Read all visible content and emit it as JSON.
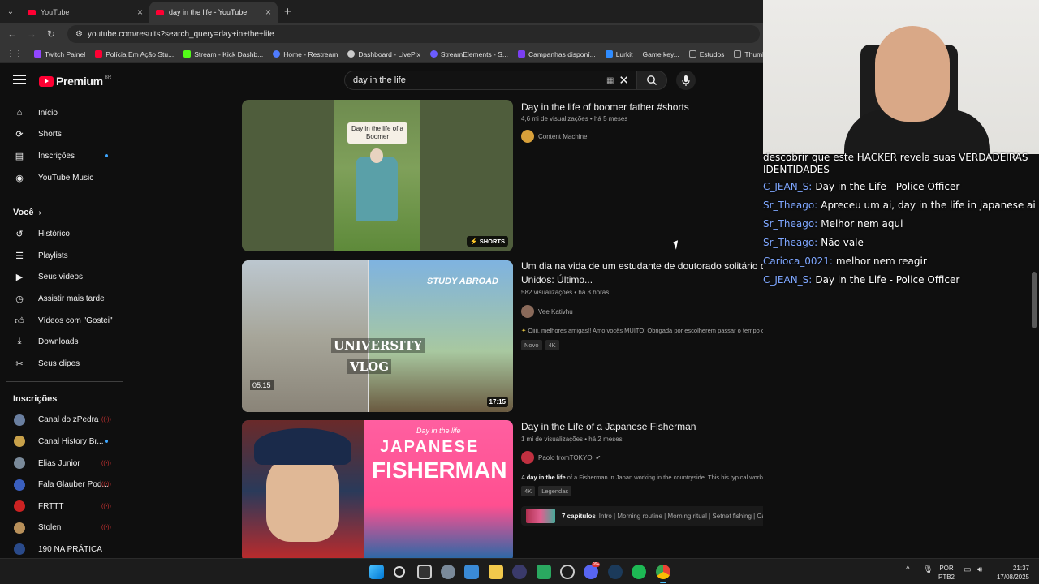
{
  "browser": {
    "tabs": [
      {
        "label": "YouTube",
        "active": false
      },
      {
        "label": "day in the life - YouTube",
        "active": true
      }
    ],
    "url": "youtube.com/results?search_query=day+in+the+life",
    "bookmarks": [
      {
        "label": "Twitch Painel",
        "color": "#9146ff"
      },
      {
        "label": "Polícia Em Ação Stu...",
        "color": "#ff0033"
      },
      {
        "label": "Stream - Kick Dashb...",
        "color": "#53fc18"
      },
      {
        "label": "Home - Restream",
        "color": "#4f7cff"
      },
      {
        "label": "Dashboard - LivePix",
        "color": "#cccccc"
      },
      {
        "label": "StreamElements - S...",
        "color": "#6b5cff"
      },
      {
        "label": "Campanhas disponí...",
        "color": "#7b3ff2"
      },
      {
        "label": "Lurkit",
        "color": "#2f8cff"
      },
      {
        "label": "Game key...",
        "color": "#888888"
      },
      {
        "label": "Estudos",
        "color": "#aaaaaa"
      },
      {
        "label": "Thumbnails",
        "color": "#aaaaaa"
      }
    ]
  },
  "header": {
    "logo_text": "Premium",
    "logo_region": "BR",
    "search_value": "day in the life"
  },
  "sidebar": {
    "main": [
      {
        "label": "Início",
        "icon": "home-icon"
      },
      {
        "label": "Shorts",
        "icon": "shorts-icon"
      },
      {
        "label": "Inscrições",
        "icon": "subscriptions-icon",
        "dot": true
      },
      {
        "label": "YouTube Music",
        "icon": "music-icon"
      }
    ],
    "you_heading": "Você",
    "you": [
      {
        "label": "Histórico",
        "icon": "history-icon"
      },
      {
        "label": "Playlists",
        "icon": "playlists-icon"
      },
      {
        "label": "Seus vídeos",
        "icon": "your-videos-icon"
      },
      {
        "label": "Assistir mais tarde",
        "icon": "watch-later-icon"
      },
      {
        "label": "Vídeos com \"Gostei\"",
        "icon": "liked-icon"
      },
      {
        "label": "Downloads",
        "icon": "download-icon"
      },
      {
        "label": "Seus clipes",
        "icon": "clips-icon"
      }
    ],
    "subs_heading": "Inscrições",
    "subs": [
      {
        "label": "Canal do zPedra",
        "color": "#6a7fa0",
        "status": "live"
      },
      {
        "label": "Canal History Br...",
        "color": "#c8a14a",
        "status": "dot"
      },
      {
        "label": "Elias Junior",
        "color": "#7a8a9a",
        "status": "live"
      },
      {
        "label": "Fala Glauber Pod...",
        "color": "#3a5fbf",
        "status": "live"
      },
      {
        "label": "FRTTT",
        "color": "#cc2222",
        "status": "live"
      },
      {
        "label": "Stolen",
        "color": "#b8905a",
        "status": "live"
      },
      {
        "label": "190 NA PRÁTICA",
        "color": "#2a4a8a",
        "status": ""
      }
    ]
  },
  "results": [
    {
      "title": "Day in the life of boomer father #shorts",
      "meta": "4,6 mi de visualizações • há 5 meses",
      "channel": "Content Machine",
      "badge": "SHORTS",
      "thumb_caption": "Day in the life of a Boomer"
    },
    {
      "title_line1": "Um dia na vida de um estudante de doutorado solitário que vive sozinho nos Estados",
      "title_line2": "Unidos: Último...",
      "meta": "582 visualizações • há 3 horas",
      "channel": "Vee Kativhu",
      "desc": "Oiiii, melhores amigas!! Amo vocês MUITO! Obrigada por escolherem passar o tempo comigo no vídeo de hoje! Significa muito ...",
      "badges": [
        "Novo",
        "4K"
      ],
      "duration": "17:15",
      "thumb_texts": [
        "STUDY ABROAD",
        "UNIVERSITY",
        "VLOG",
        "05:15"
      ]
    },
    {
      "title": "Day in the Life of a Japanese Fisherman",
      "meta": "1 mi de visualizações • há 2 meses",
      "channel": "Paolo fromTOKYO",
      "desc_bold": "day in the life",
      "desc_pre": "A ",
      "desc_post": " of a Fisherman in Japan working in the countryside. This his typical workday from early morning until he finishes ...",
      "badges": [
        "4K",
        "Legendas"
      ],
      "chapters_count": "7 capítulos",
      "chapters_list": "Intro | Morning routine | Morning ritual | Setnet fishing | Catching fish | Auctioning fish | Lunch",
      "thumb_texts": [
        "Day in the life",
        "JAPANESE",
        "FISHERMAN"
      ]
    }
  ],
  "chat": [
    {
      "user": "",
      "text": "descobrir que este HACKER revela suas VERDADEIRAS"
    },
    {
      "user": "",
      "text": "IDENTIDADES"
    },
    {
      "user": "C_JEAN_S:",
      "text": "Day in the Life - Police Officer"
    },
    {
      "user": "Sr_Theago:",
      "text": "Apreceu um ai, day in the life in japanese ai"
    },
    {
      "user": "Sr_Theago:",
      "text": "Melhor nem aqui"
    },
    {
      "user": "Sr_Theago:",
      "text": "Não vale"
    },
    {
      "user": "Carioca_0021:",
      "text": "melhor nem reagir"
    },
    {
      "user": "C_JEAN_S:",
      "text": "Day in the Life - Police Officer"
    }
  ],
  "taskbar": {
    "lang_top": "POR",
    "lang_bottom": "PTB2",
    "time": "21:37",
    "date": "17/08/2025",
    "badge_count": "99+"
  }
}
